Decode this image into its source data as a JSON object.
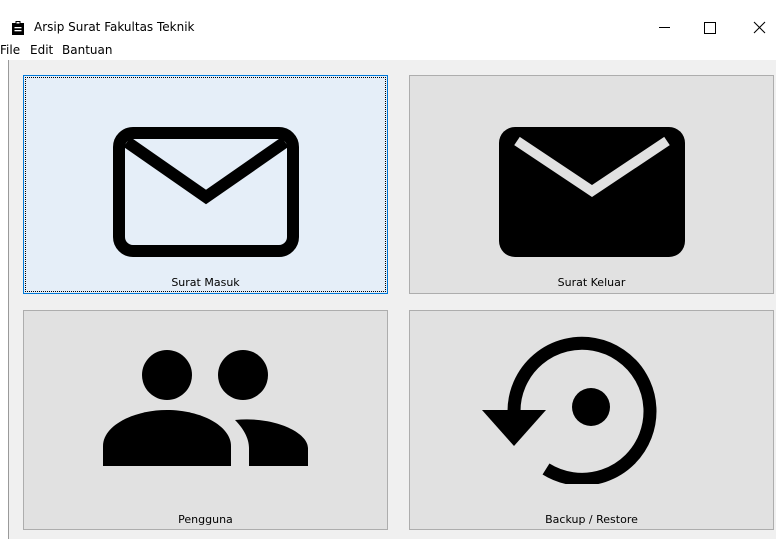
{
  "window": {
    "title": "Arsip Surat Fakultas Teknik",
    "icon": "clipboard-icon",
    "controls": [
      "minimize-icon",
      "maximize-icon",
      "close-icon"
    ]
  },
  "menu": {
    "items": [
      "File",
      "Edit",
      "Bantuan"
    ]
  },
  "tiles": [
    {
      "label": "Surat Masuk",
      "icon": "envelope-outline-icon",
      "focused": true
    },
    {
      "label": "Surat Keluar",
      "icon": "envelope-filled-icon",
      "focused": false
    },
    {
      "label": "Pengguna",
      "icon": "users-icon",
      "focused": false
    },
    {
      "label": "Backup / Restore",
      "icon": "restore-icon",
      "focused": false
    }
  ],
  "colors": {
    "tile_background": "#e1e1e1",
    "tile_focused_background": "#e5eef8",
    "focus_border": "#0078d7",
    "client_background": "#f0f0f0",
    "icon_color": "#000000"
  }
}
